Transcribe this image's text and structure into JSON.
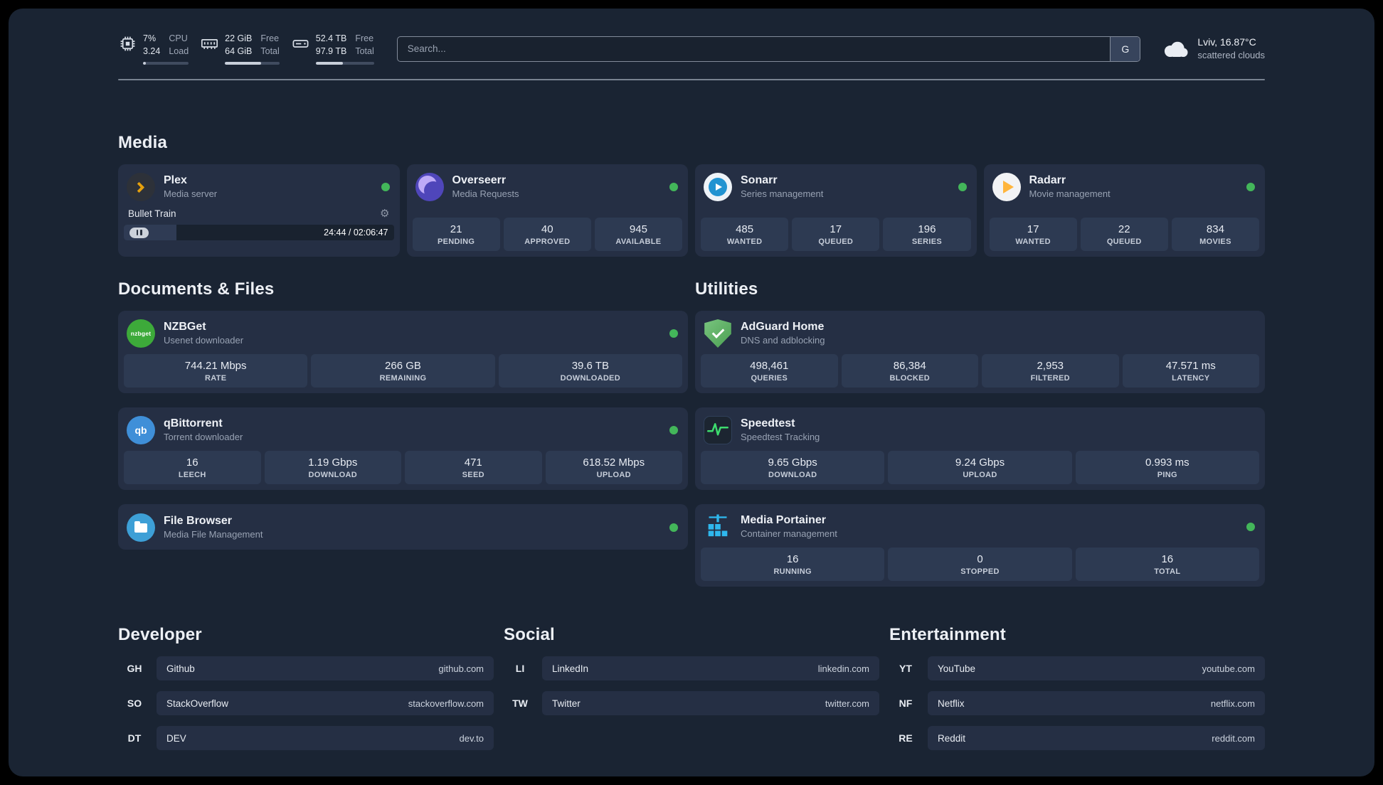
{
  "colors": {
    "status_online": "#43b65a"
  },
  "topbar": {
    "cpu": {
      "value_top": "7%",
      "value_bottom": "3.24",
      "label_top": "CPU",
      "label_bottom": "Load",
      "bar_percent": 7
    },
    "ram": {
      "value_top": "22 GiB",
      "value_bottom": "64 GiB",
      "label_top": "Free",
      "label_bottom": "Total",
      "bar_percent": 66
    },
    "disk": {
      "value_top": "52.4 TB",
      "value_bottom": "97.9 TB",
      "label_top": "Free",
      "label_bottom": "Total",
      "bar_percent": 47
    },
    "search": {
      "placeholder": "Search...",
      "provider_label": "G"
    },
    "weather": {
      "location": "Lviv, 16.87°C",
      "condition": "scattered clouds"
    }
  },
  "sections": {
    "media": {
      "title": "Media",
      "plex": {
        "name": "Plex",
        "subtitle": "Media server",
        "now_playing": "Bullet Train",
        "time": "24:44 / 02:06:47",
        "progress_percent": 19.5
      },
      "overseerr": {
        "name": "Overseerr",
        "subtitle": "Media Requests",
        "stats": [
          {
            "value": "21",
            "label": "PENDING"
          },
          {
            "value": "40",
            "label": "APPROVED"
          },
          {
            "value": "945",
            "label": "AVAILABLE"
          }
        ]
      },
      "sonarr": {
        "name": "Sonarr",
        "subtitle": "Series management",
        "stats": [
          {
            "value": "485",
            "label": "WANTED"
          },
          {
            "value": "17",
            "label": "QUEUED"
          },
          {
            "value": "196",
            "label": "SERIES"
          }
        ]
      },
      "radarr": {
        "name": "Radarr",
        "subtitle": "Movie management",
        "stats": [
          {
            "value": "17",
            "label": "WANTED"
          },
          {
            "value": "22",
            "label": "QUEUED"
          },
          {
            "value": "834",
            "label": "MOVIES"
          }
        ]
      }
    },
    "documents": {
      "title": "Documents & Files",
      "nzbget": {
        "name": "NZBGet",
        "subtitle": "Usenet downloader",
        "icon_text": "nzbget",
        "stats": [
          {
            "value": "744.21 Mbps",
            "label": "RATE"
          },
          {
            "value": "266 GB",
            "label": "REMAINING"
          },
          {
            "value": "39.6 TB",
            "label": "DOWNLOADED"
          }
        ]
      },
      "qbittorrent": {
        "name": "qBittorrent",
        "subtitle": "Torrent downloader",
        "icon_text": "qb",
        "stats": [
          {
            "value": "16",
            "label": "LEECH"
          },
          {
            "value": "1.19 Gbps",
            "label": "DOWNLOAD"
          },
          {
            "value": "471",
            "label": "SEED"
          },
          {
            "value": "618.52 Mbps",
            "label": "UPLOAD"
          }
        ]
      },
      "filebrowser": {
        "name": "File Browser",
        "subtitle": "Media File Management"
      }
    },
    "utilities": {
      "title": "Utilities",
      "adguard": {
        "name": "AdGuard Home",
        "subtitle": "DNS and adblocking",
        "stats": [
          {
            "value": "498,461",
            "label": "QUERIES"
          },
          {
            "value": "86,384",
            "label": "BLOCKED"
          },
          {
            "value": "2,953",
            "label": "FILTERED"
          },
          {
            "value": "47.571 ms",
            "label": "LATENCY"
          }
        ]
      },
      "speedtest": {
        "name": "Speedtest",
        "subtitle": "Speedtest Tracking",
        "stats": [
          {
            "value": "9.65 Gbps",
            "label": "DOWNLOAD"
          },
          {
            "value": "9.24 Gbps",
            "label": "UPLOAD"
          },
          {
            "value": "0.993 ms",
            "label": "PING"
          }
        ]
      },
      "portainer": {
        "name": "Media Portainer",
        "subtitle": "Container management",
        "stats": [
          {
            "value": "16",
            "label": "RUNNING"
          },
          {
            "value": "0",
            "label": "STOPPED"
          },
          {
            "value": "16",
            "label": "TOTAL"
          }
        ]
      }
    },
    "bookmarks": {
      "developer": {
        "title": "Developer",
        "items": [
          {
            "abbr": "GH",
            "name": "Github",
            "url": "github.com"
          },
          {
            "abbr": "SO",
            "name": "StackOverflow",
            "url": "stackoverflow.com"
          },
          {
            "abbr": "DT",
            "name": "DEV",
            "url": "dev.to"
          }
        ]
      },
      "social": {
        "title": "Social",
        "items": [
          {
            "abbr": "LI",
            "name": "LinkedIn",
            "url": "linkedin.com"
          },
          {
            "abbr": "TW",
            "name": "Twitter",
            "url": "twitter.com"
          }
        ]
      },
      "entertainment": {
        "title": "Entertainment",
        "items": [
          {
            "abbr": "YT",
            "name": "YouTube",
            "url": "youtube.com"
          },
          {
            "abbr": "NF",
            "name": "Netflix",
            "url": "netflix.com"
          },
          {
            "abbr": "RE",
            "name": "Reddit",
            "url": "reddit.com"
          }
        ]
      }
    }
  },
  "icons": {
    "search_provider": "G",
    "gear": "⚙"
  }
}
